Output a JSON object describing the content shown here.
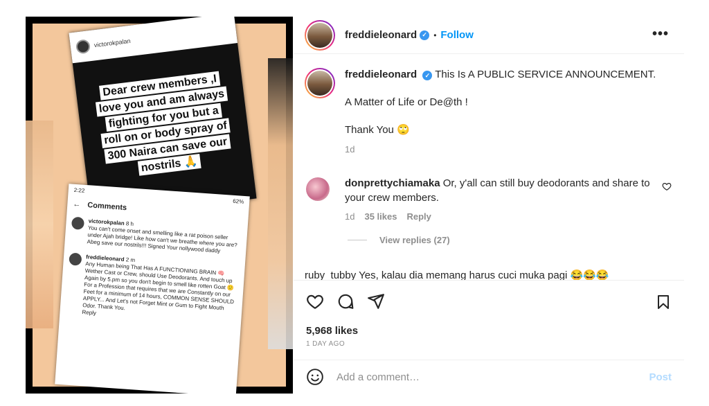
{
  "media": {
    "story_handle": "victorokpalan",
    "story_text_lines": [
      "Dear crew members ,I",
      "love you and am always",
      "fighting for you but a",
      "roll on or body spray of",
      "300 Naira can save our",
      "nostrils 🙏"
    ],
    "comments_shot": {
      "time": "2:22",
      "battery": "62%",
      "title": "Comments",
      "c1_name": "victorokpalan",
      "c1_time": "8 h",
      "c1_text": "You can't come onset and smelling like a rat poison seller under Ajah bridge! Like how can't we breathe where you are? Abeg save our nostrils!!! Signed Your nollywood daddy",
      "c2_name": "freddieleonard",
      "c2_time": "2 m",
      "c2_text": "Any Human being That Has A FUNCTIONING BRAIN 🧠 Wether Cast or Crew, should Use Deodorants. And touch up Again by 5.pm so you don't begin to smell like rotten Goat 🙂 For a Profession that requires that we are Constantly on our Feet for a minimum of 14 hours, COMMON SENSE SHOULD APPLY... And Let's not Forget Mint or Gum to Fight Mouth Odor. Thank You.",
      "reply": "Reply"
    }
  },
  "header": {
    "username": "freddieleonard",
    "follow_label": "Follow",
    "more_label": "•••"
  },
  "caption": {
    "username": "freddieleonard",
    "line1": "This Is A PUBLIC SERVICE ANNOUNCEMENT.",
    "line2": "A Matter of Life or De@th !",
    "line3": "Thank You 🙄",
    "age": "1d"
  },
  "comment": {
    "username": "donprettychiamaka",
    "text": "Or, y'all can still buy deodorants and share to your crew members.",
    "age": "1d",
    "likes": "35 likes",
    "reply": "Reply",
    "view_replies": "View replies (27)"
  },
  "cut_comment": "ruby_tubby Yes, kalau dia memang harus cuci muka pagi 😂😂😂",
  "likes": "5,968 likes",
  "timestamp": "1 DAY AGO",
  "add_comment": {
    "placeholder": "Add a comment…",
    "post_label": "Post"
  },
  "colors": {
    "accent": "#0095f6",
    "verified": "#3897f0",
    "post_disabled": "#b3dbff"
  }
}
